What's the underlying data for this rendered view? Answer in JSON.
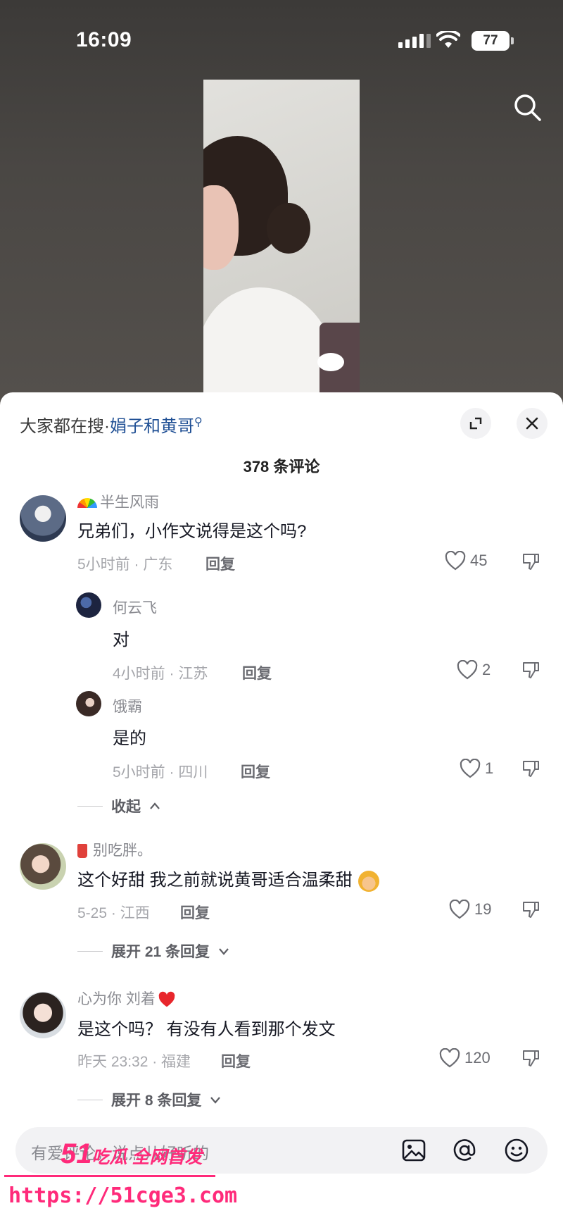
{
  "status_bar": {
    "time": "16:09",
    "battery": "77"
  },
  "sheet": {
    "hot_search_label": "大家都在搜·",
    "hot_search_keyword": "娟子和黄哥",
    "comment_count": "378 条评论"
  },
  "comments": [
    {
      "user": "半生风雨",
      "text": "兄弟们，小作文说得是这个吗?",
      "meta": "5小时前 · 广东",
      "reply_label": "回复",
      "likes": "45",
      "replies": [
        {
          "user": "何云飞",
          "text": "对",
          "meta": "4小时前 · 江苏",
          "reply_label": "回复",
          "likes": "2"
        },
        {
          "user": "饿霸",
          "text": "是的",
          "meta": "5小时前 · 四川",
          "reply_label": "回复",
          "likes": "1"
        }
      ],
      "collapse_label": "收起"
    },
    {
      "user": "别吃胖。",
      "text": "这个好甜  我之前就说黄哥适合温柔甜",
      "meta": "5-25 · 江西",
      "reply_label": "回复",
      "likes": "19",
      "expand_label": "展开 21 条回复"
    },
    {
      "user": "心为你  刘着",
      "text": "是这个吗？ 有没有人看到那个发文",
      "meta": "昨天 23:32 · 福建",
      "reply_label": "回复",
      "likes": "120",
      "expand_label": "展开 8 条回复"
    }
  ],
  "input": {
    "placeholder": "有爱评论，说点儿好听的"
  },
  "watermark": {
    "number": "51",
    "text": "吃瓜 全网首发",
    "url": "https://51cge3.com"
  },
  "icons": [
    "search-icon",
    "expand-icon",
    "close-icon",
    "heart-icon",
    "dislike-icon",
    "image-icon",
    "at-icon",
    "emoji-icon",
    "rainbow-icon",
    "drink-icon",
    "red-heart-icon"
  ],
  "colors": {
    "link": "#1f4f94",
    "watermark": "#ff2a7a"
  }
}
